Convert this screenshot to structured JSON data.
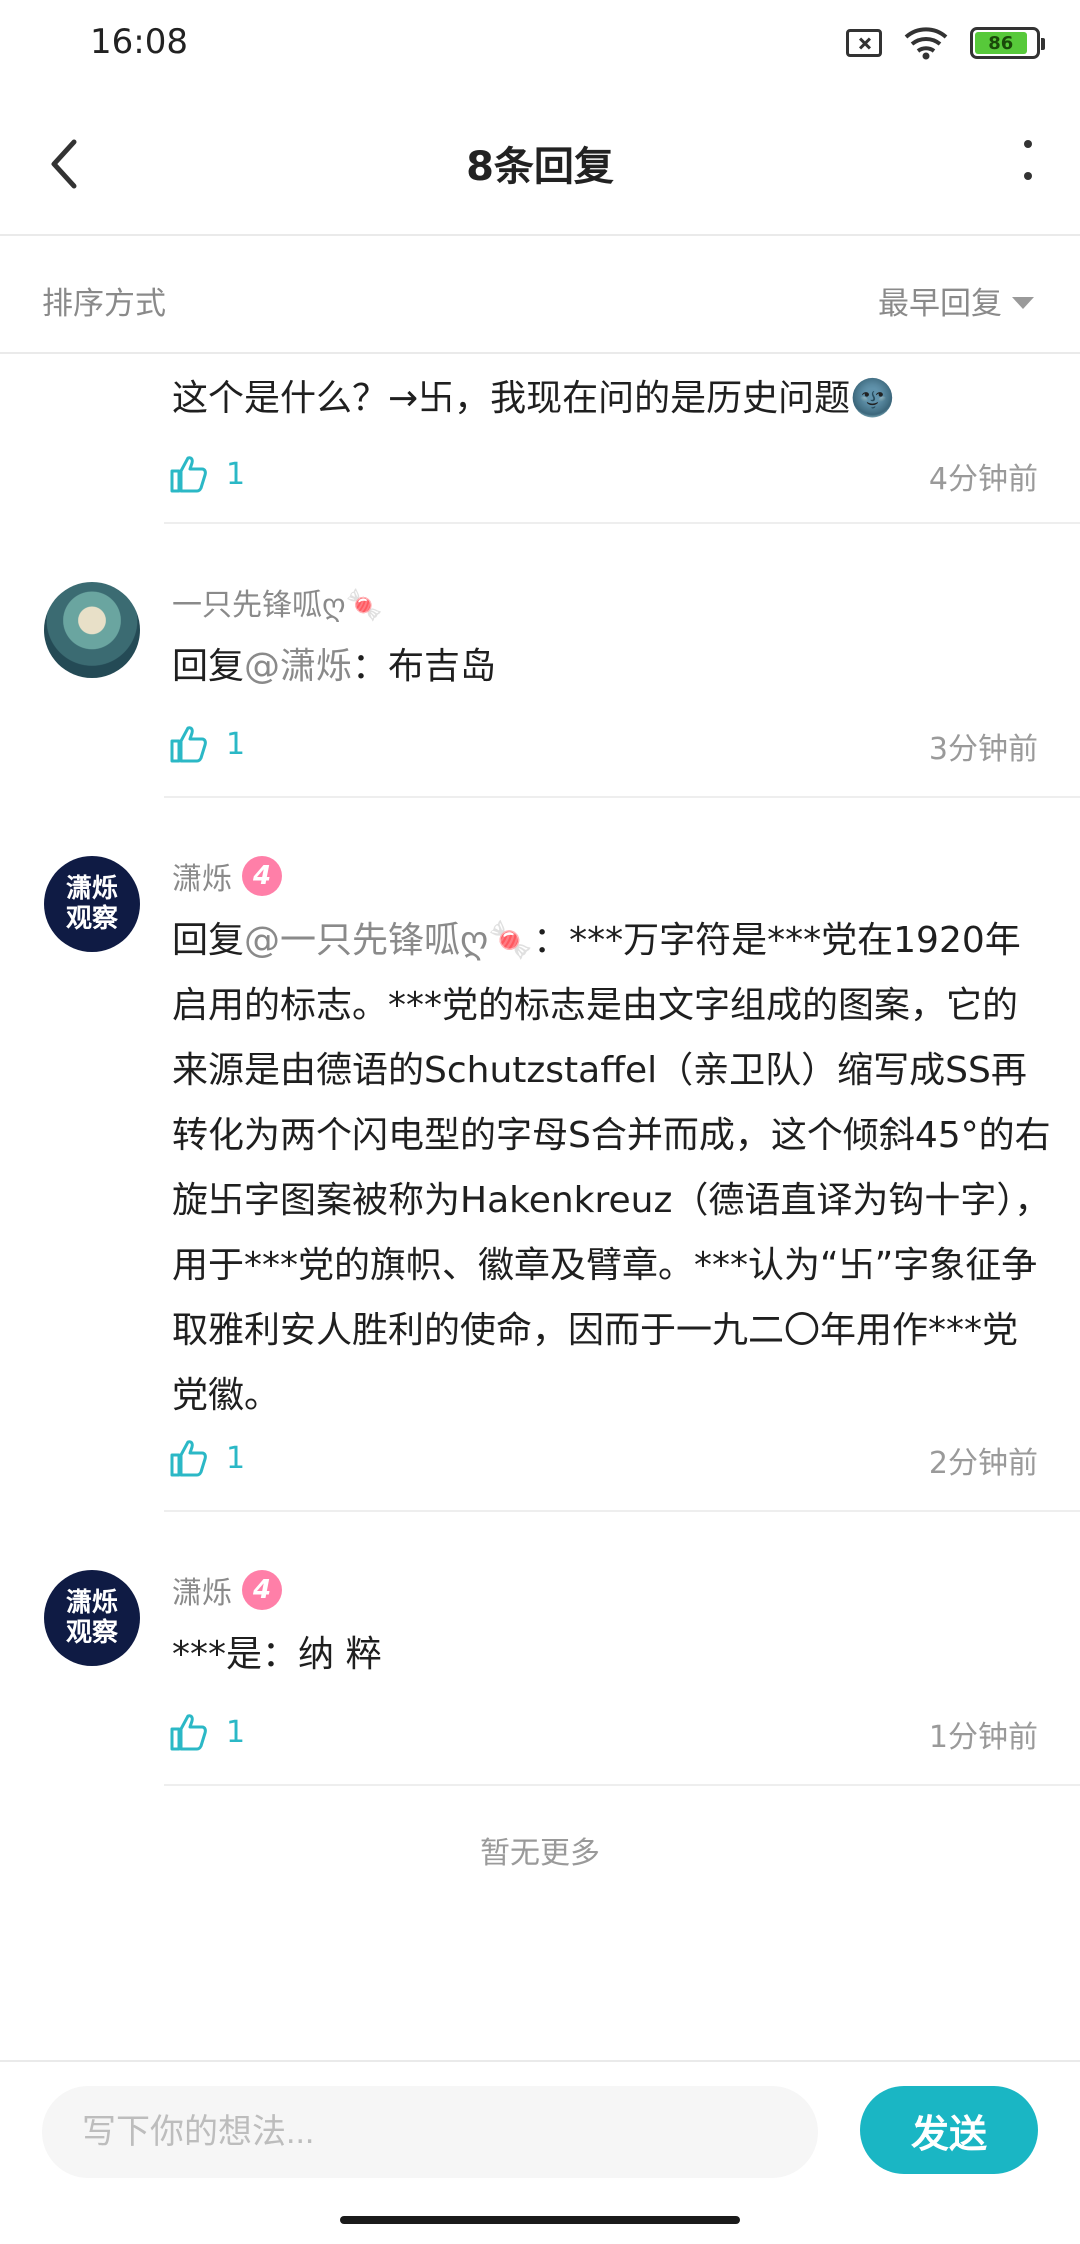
{
  "status_bar": {
    "time": "16:08",
    "battery": "86",
    "battery_level": 0.86
  },
  "header": {
    "title": "8条回复"
  },
  "sort": {
    "label": "排序方式",
    "selected": "最早回复"
  },
  "comments": [
    {
      "text": "这个是什么？→卐，我现在问的是历史问题🌚",
      "likes": "1",
      "time": "4分钟前"
    },
    {
      "username": "一只先锋呱ღ🍬",
      "reply_prefix": "回复",
      "mention": "@潇烁",
      "text": "：布吉岛",
      "likes": "1",
      "time": "3分钟前"
    },
    {
      "username": "潇烁",
      "level": "4",
      "avatar_text_1": "潇烁",
      "avatar_text_2": "观察",
      "reply_prefix": "回复",
      "mention": "@一只先锋呱ღ🍬",
      "text": "：***万字符是***党在1920年启用的标志。***党的标志是由文字组成的图案，它的来源是由德语的Schutzstaffel（亲卫队）缩写成SS再转化为两个闪电型的字母S合并而成，这个倾斜45°的右旋卐字图案被称为Hakenkreuz（德语直译为钩十字），用于***党的旗帜、徽章及臂章。***认为“卐”字象征争取雅利安人胜利的使命，因而于一九二〇年用作***党党徽。",
      "likes": "1",
      "time": "2分钟前"
    },
    {
      "username": "潇烁",
      "level": "4",
      "avatar_text_1": "潇烁",
      "avatar_text_2": "观察",
      "text": "***是：纳 粹",
      "likes": "1",
      "time": "1分钟前"
    }
  ],
  "footer": {
    "no_more": "暂无更多"
  },
  "composer": {
    "placeholder": "写下你的想法...",
    "send_label": "发送"
  },
  "colors": {
    "accent": "#1ab6c4",
    "like": "#2bb8c6",
    "level_badge": "#ff7fa8",
    "battery": "#57c93a"
  }
}
